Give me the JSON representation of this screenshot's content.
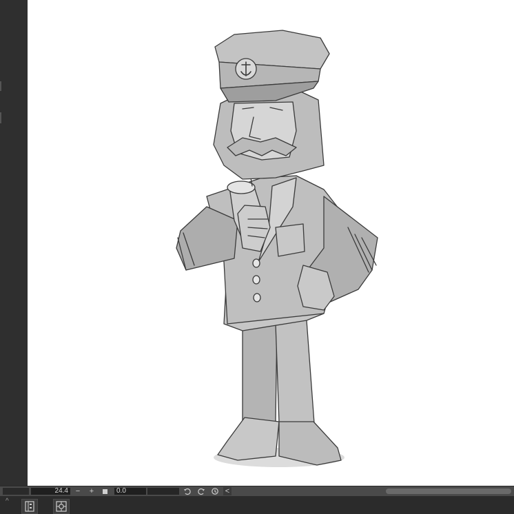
{
  "status_bar": {
    "zoom_value": "24.4",
    "zoom_out_symbol": "−",
    "zoom_in_symbol": "+",
    "rotation_value": "0.0",
    "scroll_left_symbol": "<"
  },
  "canvas": {
    "artwork": "sea captain character sketch",
    "background_color": "#ffffff"
  },
  "icons": {
    "rotate_left": "rotate-left-icon",
    "rotate_right": "rotate-right-icon",
    "reset_rotation": "reset-rotation-icon",
    "layer_panel": "layer-panel-icon",
    "navigator": "navigator-icon"
  }
}
